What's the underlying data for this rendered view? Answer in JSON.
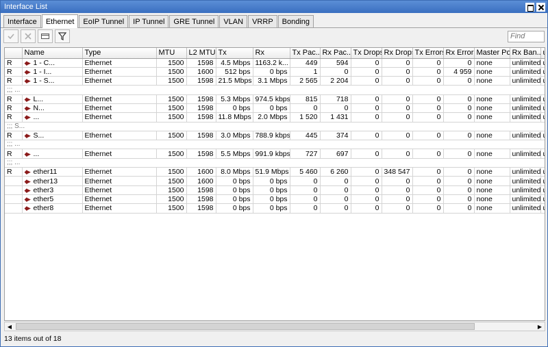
{
  "window": {
    "title": "Interface List"
  },
  "tabs": [
    "Interface",
    "Ethernet",
    "EoIP Tunnel",
    "IP Tunnel",
    "GRE Tunnel",
    "VLAN",
    "VRRP",
    "Bonding"
  ],
  "active_tab": 1,
  "toolbar": {
    "find_placeholder": "Find"
  },
  "columns": [
    "",
    "Name",
    "Type",
    "MTU",
    "L2 MTU",
    "Tx",
    "Rx",
    "Tx Pac...",
    "Rx Pac...",
    "Tx Drops",
    "Rx Drops",
    "Tx Errors",
    "Rx Errors",
    "Master Port",
    "Rx Ban...",
    "u"
  ],
  "rows": [
    {
      "kind": "row",
      "flag": "R",
      "name": "1 - C...",
      "type": "Ethernet",
      "mtu": "1500",
      "l2mtu": "1598",
      "tx": "4.5 Mbps",
      "rx": "1163.2 k...",
      "txp": "449",
      "rxp": "594",
      "txd": "0",
      "rxd": "0",
      "txe": "0",
      "rxe": "0",
      "master": "none",
      "rxban": "unlimited",
      "u": "u"
    },
    {
      "kind": "row",
      "flag": "R",
      "name": "1 - I...",
      "type": "Ethernet",
      "mtu": "1500",
      "l2mtu": "1600",
      "tx": "512 bps",
      "rx": "0 bps",
      "txp": "1",
      "rxp": "0",
      "txd": "0",
      "rxd": "0",
      "txe": "0",
      "rxe": "4 959",
      "master": "none",
      "rxban": "unlimited",
      "u": "u"
    },
    {
      "kind": "row",
      "flag": "R",
      "name": "1 - S...",
      "type": "Ethernet",
      "mtu": "1500",
      "l2mtu": "1598",
      "tx": "21.5 Mbps",
      "rx": "3.1 Mbps",
      "txp": "2 565",
      "rxp": "2 204",
      "txd": "0",
      "rxd": "0",
      "txe": "0",
      "rxe": "0",
      "master": "none",
      "rxban": "unlimited",
      "u": "u"
    },
    {
      "kind": "comment",
      "text": ";;; ..."
    },
    {
      "kind": "row",
      "flag": "R",
      "name": "L...",
      "type": "Ethernet",
      "mtu": "1500",
      "l2mtu": "1598",
      "tx": "5.3 Mbps",
      "rx": "974.5 kbps",
      "txp": "815",
      "rxp": "718",
      "txd": "0",
      "rxd": "0",
      "txe": "0",
      "rxe": "0",
      "master": "none",
      "rxban": "unlimited",
      "u": "u"
    },
    {
      "kind": "row",
      "flag": "R",
      "name": "N...",
      "type": "Ethernet",
      "mtu": "1500",
      "l2mtu": "1598",
      "tx": "0 bps",
      "rx": "0 bps",
      "txp": "0",
      "rxp": "0",
      "txd": "0",
      "rxd": "0",
      "txe": "0",
      "rxe": "0",
      "master": "none",
      "rxban": "unlimited",
      "u": "u"
    },
    {
      "kind": "row",
      "flag": "R",
      "name": "...",
      "type": "Ethernet",
      "mtu": "1500",
      "l2mtu": "1598",
      "tx": "11.8 Mbps",
      "rx": "2.0 Mbps",
      "txp": "1 520",
      "rxp": "1 431",
      "txd": "0",
      "rxd": "0",
      "txe": "0",
      "rxe": "0",
      "master": "none",
      "rxban": "unlimited",
      "u": "u"
    },
    {
      "kind": "comment",
      "text": ";;; S..."
    },
    {
      "kind": "row",
      "flag": "R",
      "name": "S...",
      "type": "Ethernet",
      "mtu": "1500",
      "l2mtu": "1598",
      "tx": "3.0 Mbps",
      "rx": "788.9 kbps",
      "txp": "445",
      "rxp": "374",
      "txd": "0",
      "rxd": "0",
      "txe": "0",
      "rxe": "0",
      "master": "none",
      "rxban": "unlimited",
      "u": "u"
    },
    {
      "kind": "comment",
      "text": ";;; ..."
    },
    {
      "kind": "row",
      "flag": "R",
      "name": "...",
      "type": "Ethernet",
      "mtu": "1500",
      "l2mtu": "1598",
      "tx": "5.5 Mbps",
      "rx": "991.9 kbps",
      "txp": "727",
      "rxp": "697",
      "txd": "0",
      "rxd": "0",
      "txe": "0",
      "rxe": "0",
      "master": "none",
      "rxban": "unlimited",
      "u": "u"
    },
    {
      "kind": "comment",
      "text": ";;; ..."
    },
    {
      "kind": "row",
      "flag": "R",
      "name": "ether11",
      "type": "Ethernet",
      "mtu": "1500",
      "l2mtu": "1600",
      "tx": "8.0 Mbps",
      "rx": "51.9 Mbps",
      "txp": "5 460",
      "rxp": "6 260",
      "txd": "0",
      "rxd": "348 547",
      "txe": "0",
      "rxe": "0",
      "master": "none",
      "rxban": "unlimited",
      "u": "u"
    },
    {
      "kind": "row",
      "flag": "",
      "name": "ether13",
      "type": "Ethernet",
      "mtu": "1500",
      "l2mtu": "1600",
      "tx": "0 bps",
      "rx": "0 bps",
      "txp": "0",
      "rxp": "0",
      "txd": "0",
      "rxd": "0",
      "txe": "0",
      "rxe": "0",
      "master": "none",
      "rxban": "unlimited",
      "u": "u"
    },
    {
      "kind": "row",
      "flag": "",
      "name": "ether3",
      "type": "Ethernet",
      "mtu": "1500",
      "l2mtu": "1598",
      "tx": "0 bps",
      "rx": "0 bps",
      "txp": "0",
      "rxp": "0",
      "txd": "0",
      "rxd": "0",
      "txe": "0",
      "rxe": "0",
      "master": "none",
      "rxban": "unlimited",
      "u": "u"
    },
    {
      "kind": "row",
      "flag": "",
      "name": "ether5",
      "type": "Ethernet",
      "mtu": "1500",
      "l2mtu": "1598",
      "tx": "0 bps",
      "rx": "0 bps",
      "txp": "0",
      "rxp": "0",
      "txd": "0",
      "rxd": "0",
      "txe": "0",
      "rxe": "0",
      "master": "none",
      "rxban": "unlimited",
      "u": "u"
    },
    {
      "kind": "row",
      "flag": "",
      "name": "ether8",
      "type": "Ethernet",
      "mtu": "1500",
      "l2mtu": "1598",
      "tx": "0 bps",
      "rx": "0 bps",
      "txp": "0",
      "rxp": "0",
      "txd": "0",
      "rxd": "0",
      "txe": "0",
      "rxe": "0",
      "master": "none",
      "rxban": "unlimited",
      "u": "u"
    }
  ],
  "status": {
    "text": "13 items out of 18"
  }
}
